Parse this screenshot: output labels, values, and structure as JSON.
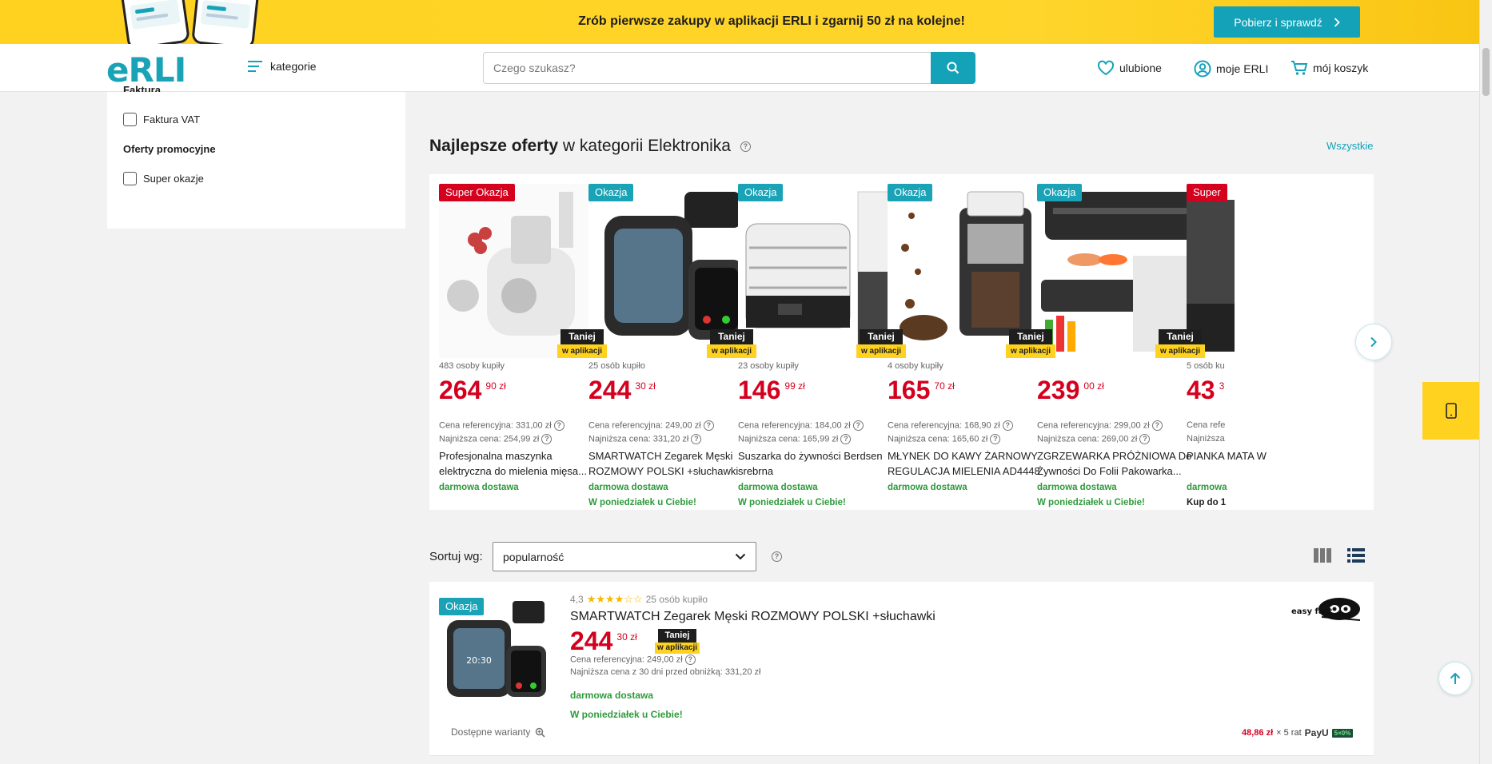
{
  "promo": {
    "text": "Zrób pierwsze zakupy w aplikacji ERLI i zgarnij 50 zł na kolejne!",
    "button": "Pobierz i sprawdź"
  },
  "header": {
    "logo": "eRLI",
    "categories": "kategorie",
    "search_placeholder": "Czego szukasz?",
    "favorites": "ulubione",
    "account": "moje ERLI",
    "cart": "mój koszyk"
  },
  "sidebar": {
    "partial_heading": "Faktura",
    "invoice_checkbox": "Faktura VAT",
    "promo_heading": "Oferty promocyjne",
    "promo_checkbox": "Super okazje"
  },
  "section": {
    "title_bold": "Najlepsze oferty",
    "title_rest": " w kategorii Elektronika",
    "see_all": "Wszystkie"
  },
  "taniej": {
    "line1": "Taniej",
    "line2": "w aplikacji"
  },
  "carousel": [
    {
      "badge": "Super Okazja",
      "badge_color": "#d4001e",
      "bought": "483 osoby kupiły",
      "price_int": "264",
      "price_dec": "90 zł",
      "ref": "Cena referencyjna: 331,00 zł",
      "low": "Najniższa cena: 254,99 zł",
      "name": "Profesjonalna maszynka elektryczna do mielenia mięsa...",
      "ship1": "darmowa dostawa",
      "ship2": ""
    },
    {
      "badge": "Okazja",
      "badge_color": "#1aa3b6",
      "bought": "25 osób kupiło",
      "price_int": "244",
      "price_dec": "30 zł",
      "ref": "Cena referencyjna: 249,00 zł",
      "low": "Najniższa cena: 331,20 zł",
      "name": "SMARTWATCH Zegarek Męski ROZMOWY POLSKI +słuchawki",
      "ship1": "darmowa dostawa",
      "ship2": "W poniedziałek u Ciebie!"
    },
    {
      "badge": "Okazja",
      "badge_color": "#1aa3b6",
      "bought": "23 osoby kupiły",
      "price_int": "146",
      "price_dec": "99 zł",
      "ref": "Cena referencyjna: 184,00 zł",
      "low": "Najniższa cena: 165,99 zł",
      "name": "Suszarka do żywności Berdsen srebrna",
      "ship1": "darmowa dostawa",
      "ship2": "W poniedziałek u Ciebie!"
    },
    {
      "badge": "Okazja",
      "badge_color": "#1aa3b6",
      "bought": "4 osoby kupiły",
      "price_int": "165",
      "price_dec": "70 zł",
      "ref": "Cena referencyjna: 168,90 zł",
      "low": "Najniższa cena: 165,60 zł",
      "name": "MŁYNEK DO KAWY ŻARNOWY REGULACJA MIELENIA AD4448",
      "ship1": "darmowa dostawa",
      "ship2": ""
    },
    {
      "badge": "Okazja",
      "badge_color": "#1aa3b6",
      "bought": "",
      "price_int": "239",
      "price_dec": "00 zł",
      "ref": "Cena referencyjna: 299,00 zł",
      "low": "Najniższa cena: 269,00 zł",
      "name": "ZGRZEWARKA PRÓŻNIOWA Do Żywności Do Folii Pakowarka...",
      "ship1": "darmowa dostawa",
      "ship2": "W poniedziałek u Ciebie!"
    },
    {
      "badge": "Super",
      "badge_color": "#d4001e",
      "bought": "5 osób ku",
      "price_int": "43",
      "price_dec": "3",
      "ref": "Cena refe",
      "low": "Najniższa",
      "name": "PIANKA MATA W",
      "ship1": "darmowa",
      "ship2": "Kup do 1"
    }
  ],
  "sort": {
    "label": "Sortuj wg:",
    "selected": "popularność"
  },
  "list_item": {
    "badge": "Okazja",
    "rating": "4,3",
    "bought": "25 osób kupiło",
    "name": "SMARTWATCH Zegarek Męski ROZMOWY POLSKI +słuchawki",
    "price_int": "244",
    "price_dec": "30 zł",
    "ref": "Cena referencyjna: 249,00 zł",
    "low": "Najniższa cena z 30 dni przed obniżką: 331,20 zł",
    "ship1": "darmowa dostawa",
    "ship2": "W poniedziałek u Ciebie!",
    "variants": "Dostępne warianty",
    "seller": "easy fast",
    "installment_amount": "48,86 zł",
    "installment_rest": "× 5 rat",
    "payu": "PayU",
    "payu_badge": "5×0%"
  },
  "colors": {
    "accent": "#14a2b9",
    "promo_yellow": "#ffd21f",
    "price_red": "#d4001e",
    "ship_green": "#2e9a3b"
  }
}
